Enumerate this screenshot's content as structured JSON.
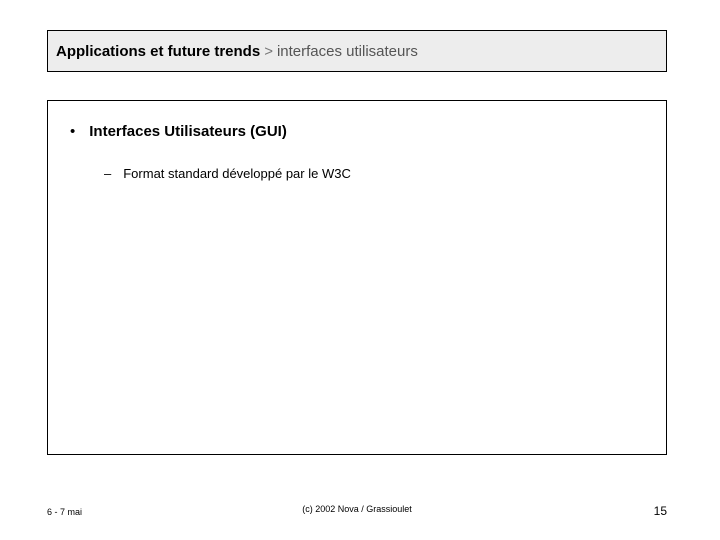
{
  "header": {
    "title_strong": "Applications et future trends",
    "separator": ">",
    "title_rest": "interfaces utilisateurs"
  },
  "body": {
    "level1_bullet": "•",
    "level1_text": "Interfaces Utilisateurs (GUI)",
    "level2_bullet": "–",
    "level2_text": "Format standard développé par le W3C"
  },
  "footer": {
    "left": "6 - 7 mai",
    "center": "(c) 2002 Nova / Grassioulet",
    "page_number": "15"
  }
}
